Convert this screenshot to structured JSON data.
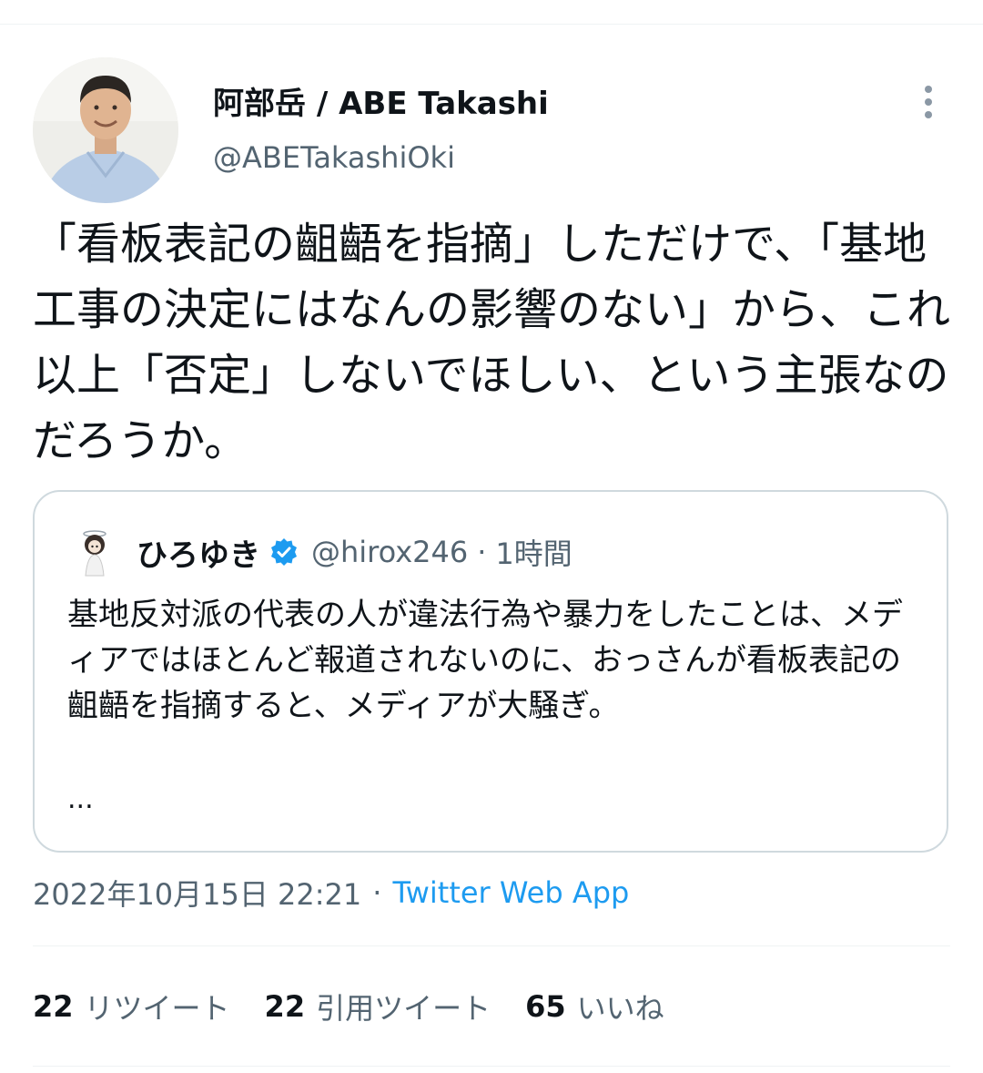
{
  "tweet": {
    "author_name": "阿部岳 / ABE Takashi",
    "author_handle": "@ABETakashiOki",
    "text": "「看板表記の齟齬を指摘」しただけで、「基地工事の決定にはなんの影響のない」から、これ以上「否定」しないでほしい、という主張なのだろうか。",
    "date": "2022年10月15日 22:21",
    "separator": "·",
    "source": "Twitter Web App"
  },
  "quote": {
    "name": "ひろゆき",
    "handle": "@hirox246",
    "separator": "·",
    "time": "1時間",
    "text": "基地反対派の代表の人が違法行為や暴力をしたことは、メディアではほとんど報道されないのに、おっさんが看板表記の齟齬を指摘すると、メディアが大騒ぎ。",
    "ellipsis": "..."
  },
  "stats": [
    {
      "count": "22",
      "label": "リツイート"
    },
    {
      "count": "22",
      "label": "引用ツイート"
    },
    {
      "count": "65",
      "label": "いいね"
    }
  ],
  "icons": {
    "more": "more-vertical-icon",
    "verified": "verified-badge-icon"
  },
  "colors": {
    "link": "#1d9bf0",
    "secondary_text": "#536471",
    "border": "#cfd9de"
  }
}
